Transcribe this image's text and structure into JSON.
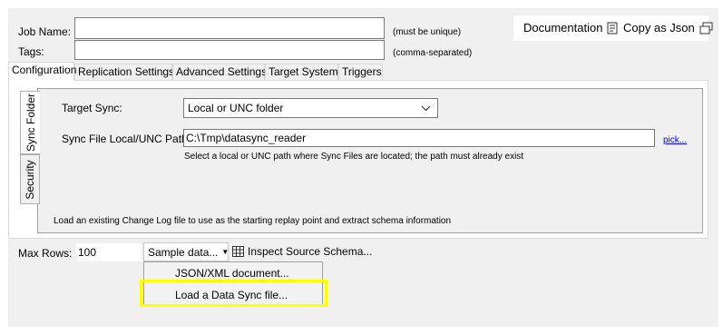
{
  "job": {
    "name_label": "Job Name:",
    "name_value": "",
    "name_hint": "(must be unique)",
    "tags_label": "Tags:",
    "tags_value": "",
    "tags_hint": "(comma-separated)"
  },
  "actions": {
    "documentation": "Documentation",
    "copy_json": "Copy as Json"
  },
  "tabs": [
    {
      "label": "Configuration"
    },
    {
      "label": "Replication Settings"
    },
    {
      "label": "Advanced Settings"
    },
    {
      "label": "Target System"
    },
    {
      "label": "Triggers"
    }
  ],
  "side_tabs": [
    {
      "label": "Sync Folder"
    },
    {
      "label": "Security"
    }
  ],
  "config": {
    "target_sync_label": "Target Sync:",
    "target_sync_value": "Local or UNC folder",
    "path_label": "Sync File Local/UNC Path:",
    "path_value": "C:\\Tmp\\datasync_reader",
    "pick_link": "pick...",
    "path_help": "Select a local or UNC path where Sync Files are located; the path must already exist",
    "load_hint": "Load an existing Change Log file to use as the starting replay point and extract schema information"
  },
  "bottom": {
    "max_rows_label": "Max Rows:",
    "max_rows_value": "100",
    "sample_button": "Sample data...",
    "inspect_button": "Inspect Source Schema..."
  },
  "menu": {
    "items": [
      {
        "label": "JSON/XML document..."
      },
      {
        "label": "Load a Data Sync file..."
      }
    ]
  }
}
